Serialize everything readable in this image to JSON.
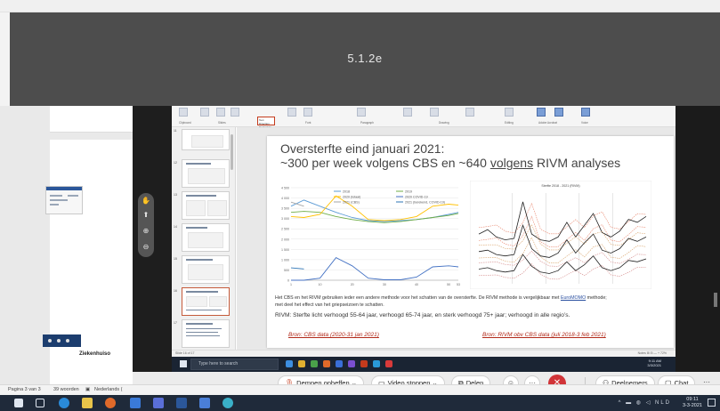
{
  "banner": {
    "title": "5.1.2e"
  },
  "word_doc": {
    "hospital_label": "Ziekenhuiso",
    "status": {
      "page": "Pagina 3 van 3",
      "words": "39 woorden",
      "language": "Nederlands ("
    }
  },
  "powerpoint": {
    "ribbon": {
      "groups": [
        "Clipboard",
        "Slides",
        "Font",
        "Paragraph",
        "Drawing",
        "Editing",
        "Adobe Acrobat",
        "Voice"
      ],
      "text_direction_box": [
        "Text Direction",
        "Convert to SmartArt"
      ]
    },
    "thumbnail_numbers": [
      "11",
      "12",
      "13",
      "14",
      "15",
      "16",
      "17"
    ],
    "slide": {
      "title_line1": "Oversterfte eind januari 2021:",
      "title_line2_a": "~300 per week volgens CBS en ~640 ",
      "title_line2_b": "volgens",
      "title_line2_c": " RIVM analyses",
      "left_chart_legend": [
        "2018",
        "2019",
        "2020 (totaal)",
        "2020 COVID-19",
        "2021 (CBS)",
        "2021 (berekend, COVID-19)"
      ],
      "right_chart_title": "Sterfte 2018 - 2021 (RIVM)",
      "body_line1_a": "Het CBS en het RIVM gebruiken ieder een andere methode voor het schatten van de oversterfte. De RIVM methode is vergelijkbaar met ",
      "body_line1_link": "EuroMOMO",
      "body_line1_b": " methode;",
      "body_line2": "met deel het effect van het griepseizoen te schatten.",
      "rivm_line": "RIVM: Sterfte licht verhoogd 55-64 jaar, verhoogd 65-74 jaar, en sterk verhoogd 75+ jaar; verhoogd in alle regio’s.",
      "source_left": "Bron: CBS data (2020-31 jan 2021)",
      "source_right": "Bron: RIVM obv CBS data (juli 2018-3 feb 2021)"
    },
    "status_left": "Slide 16 of 17",
    "status_right": "Notes  ⊞  ⊟  —  + 72%"
  },
  "inner_taskbar": {
    "search_placeholder": "Type here to search",
    "time": "9:11 AM",
    "date": "3/3/2021"
  },
  "teams_controls": {
    "unmute": "Dempen opheffen",
    "video": "Video stoppen",
    "share": "Delen",
    "participants": "Deelnemers",
    "chat": "Chat",
    "more": "···"
  },
  "taskbar": {
    "time": "09:11",
    "date": "3-3-2021",
    "sys_icons": "^ ▬ ◍ ◁ NLD"
  },
  "chart_data": [
    {
      "type": "line",
      "title": "",
      "xlabel": "week",
      "ylabel": "",
      "x_ticks": [
        "1",
        "10",
        "20",
        "30",
        "40",
        "50",
        "53"
      ],
      "y_ticks": [
        "4 500",
        "4 000",
        "3 500",
        "3 000",
        "2 500",
        "2 000",
        "1 500",
        "1 000",
        "500",
        "0"
      ],
      "ylim": [
        0,
        4500
      ],
      "x": [
        1,
        5,
        10,
        15,
        20,
        25,
        30,
        35,
        40,
        45,
        50,
        53
      ],
      "series": [
        {
          "name": "2018",
          "values": [
            3600,
            3900,
            3600,
            3300,
            3050,
            2900,
            2850,
            2900,
            2950,
            3050,
            3200,
            3300
          ]
        },
        {
          "name": "2019",
          "values": [
            3300,
            3350,
            3300,
            3100,
            2950,
            2850,
            2800,
            2850,
            2950,
            3050,
            3150,
            3250
          ]
        },
        {
          "name": "2020 (totaal)",
          "values": [
            3100,
            3050,
            3200,
            4100,
            3600,
            2950,
            2900,
            2950,
            3100,
            3600,
            3700,
            3650
          ]
        },
        {
          "name": "2020 COVID-19",
          "values": [
            0,
            0,
            100,
            1100,
            700,
            100,
            20,
            20,
            150,
            650,
            700,
            650
          ]
        },
        {
          "name": "2021 (CBS)",
          "values": [
            3800,
            3600,
            null,
            null,
            null,
            null,
            null,
            null,
            null,
            null,
            null,
            null
          ]
        },
        {
          "name": "2021 (berekend, COVID-19)",
          "values": [
            600,
            550,
            null,
            null,
            null,
            null,
            null,
            null,
            null,
            null,
            null,
            null
          ]
        }
      ]
    },
    {
      "type": "line",
      "title": "Sterfte 2018 - 2021 (RIVM)",
      "xlabel": "",
      "ylabel": "",
      "x": [
        0,
        1,
        2,
        3,
        4,
        5,
        6,
        7,
        8,
        9,
        10,
        11,
        12,
        13,
        14,
        15,
        16,
        17,
        18,
        19
      ],
      "series": [
        {
          "name": "",
          "values": [
            3200,
            3350,
            3100,
            3000,
            3050,
            4300,
            3200,
            3000,
            2950,
            3100,
            3600,
            3100,
            3500,
            3900,
            3250,
            3100,
            3300,
            3700,
            3600,
            3800
          ]
        },
        {
          "name": "",
          "values": [
            2600,
            2650,
            2500,
            2450,
            2500,
            3500,
            2700,
            2450,
            2400,
            2550,
            3000,
            2550,
            2900,
            3200,
            2650,
            2550,
            2700,
            3050,
            2950,
            3100
          ]
        },
        {
          "name": "",
          "values": [
            2000,
            2050,
            1950,
            1900,
            1950,
            2500,
            2100,
            1900,
            1850,
            1950,
            2250,
            1950,
            2150,
            2450,
            2050,
            1950,
            2050,
            2300,
            2250,
            2350
          ]
        }
      ]
    }
  ]
}
